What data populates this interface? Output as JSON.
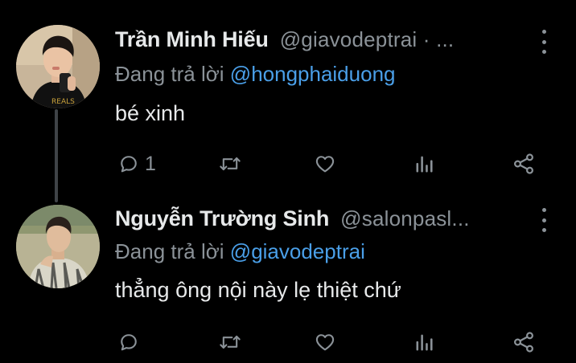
{
  "tweets": [
    {
      "display_name": "Trần Minh Hiếu",
      "handle": "@giavodeptrai · ...",
      "reply_prefix": "Đang trả lời",
      "reply_to": "@hongphaiduong",
      "text": "bé xinh",
      "reply_count": "1",
      "avatar_icon": "selfie-avatar"
    },
    {
      "display_name": "Nguyễn Trường Sinh",
      "handle": "@salonpasl...",
      "reply_prefix": "Đang trả lời",
      "reply_to": "@giavodeptrai",
      "text": "thẳng ông nội này lẹ thiệt chứ",
      "reply_count": "",
      "avatar_icon": "outdoor-avatar"
    }
  ],
  "colors": {
    "background": "#000000",
    "primary_text": "#e7e9ea",
    "secondary_text": "#8b9298",
    "mention": "#4a9fe8",
    "thread_line": "#3f4347"
  },
  "icons": [
    "reply-icon",
    "retweet-icon",
    "like-icon",
    "views-icon",
    "share-icon",
    "more-icon"
  ]
}
